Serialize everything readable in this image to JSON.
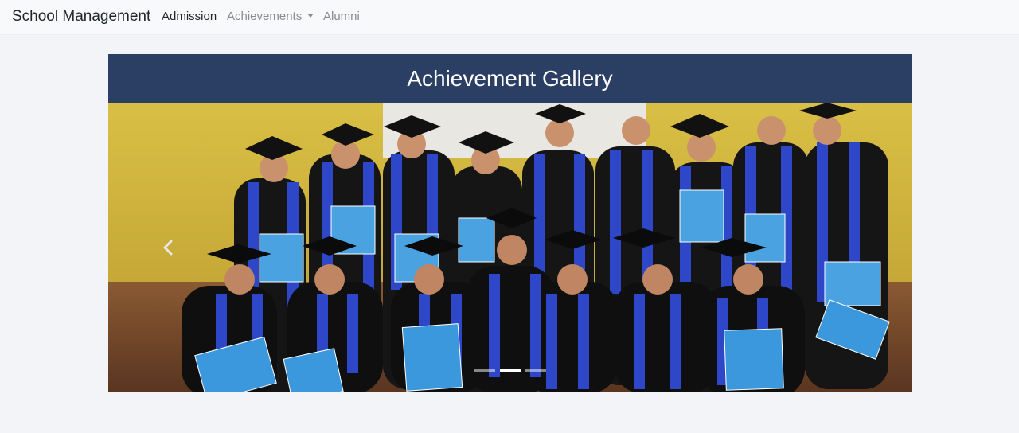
{
  "navbar": {
    "brand": "School Management",
    "links": [
      {
        "label": "Admission",
        "active": true
      },
      {
        "label": "Achievements",
        "dropdown": true
      },
      {
        "label": "Alumni"
      }
    ]
  },
  "gallery": {
    "title": "Achievement Gallery",
    "image_alt": "Graduation group photo",
    "slides_count": 3,
    "active_slide": 2
  },
  "colors": {
    "header_bg": "#2b3e63",
    "page_bg": "#f3f4f8",
    "navbar_bg": "#f8f9fa"
  }
}
